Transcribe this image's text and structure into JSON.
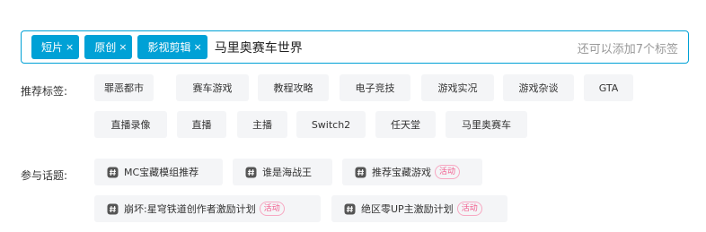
{
  "input": {
    "chips": [
      {
        "label": "短片"
      },
      {
        "label": "原创"
      },
      {
        "label": "影视剪辑"
      }
    ],
    "remove_glyph": "×",
    "current_text": "马里奥赛车世界",
    "remaining_hint": "还可以添加7个标签"
  },
  "recommended": {
    "label": "推荐标签:",
    "tags": [
      "罪恶都市",
      "赛车游戏",
      "教程攻略",
      "电子竞技",
      "游戏实况",
      "游戏杂谈",
      "GTA",
      "直播录像",
      "直播",
      "主播",
      "Switch2",
      "任天堂",
      "马里奥赛车"
    ]
  },
  "topics": {
    "label": "参与话题:",
    "items": [
      {
        "title": "MC宝藏模组推荐",
        "badge": ""
      },
      {
        "title": "谁是海战王",
        "badge": ""
      },
      {
        "title": "推荐宝藏游戏",
        "badge": "活动"
      },
      {
        "title": "崩坏:星穹铁道创作者激励计划",
        "badge": "活动"
      },
      {
        "title": "绝区零UP主激励计划",
        "badge": "活动"
      }
    ]
  },
  "colors": {
    "accent": "#00a1d6",
    "tag_bg": "#f4f5f7",
    "badge": "#f25d8e"
  },
  "icons": {
    "topic": "hash-icon",
    "remove": "close-icon"
  }
}
